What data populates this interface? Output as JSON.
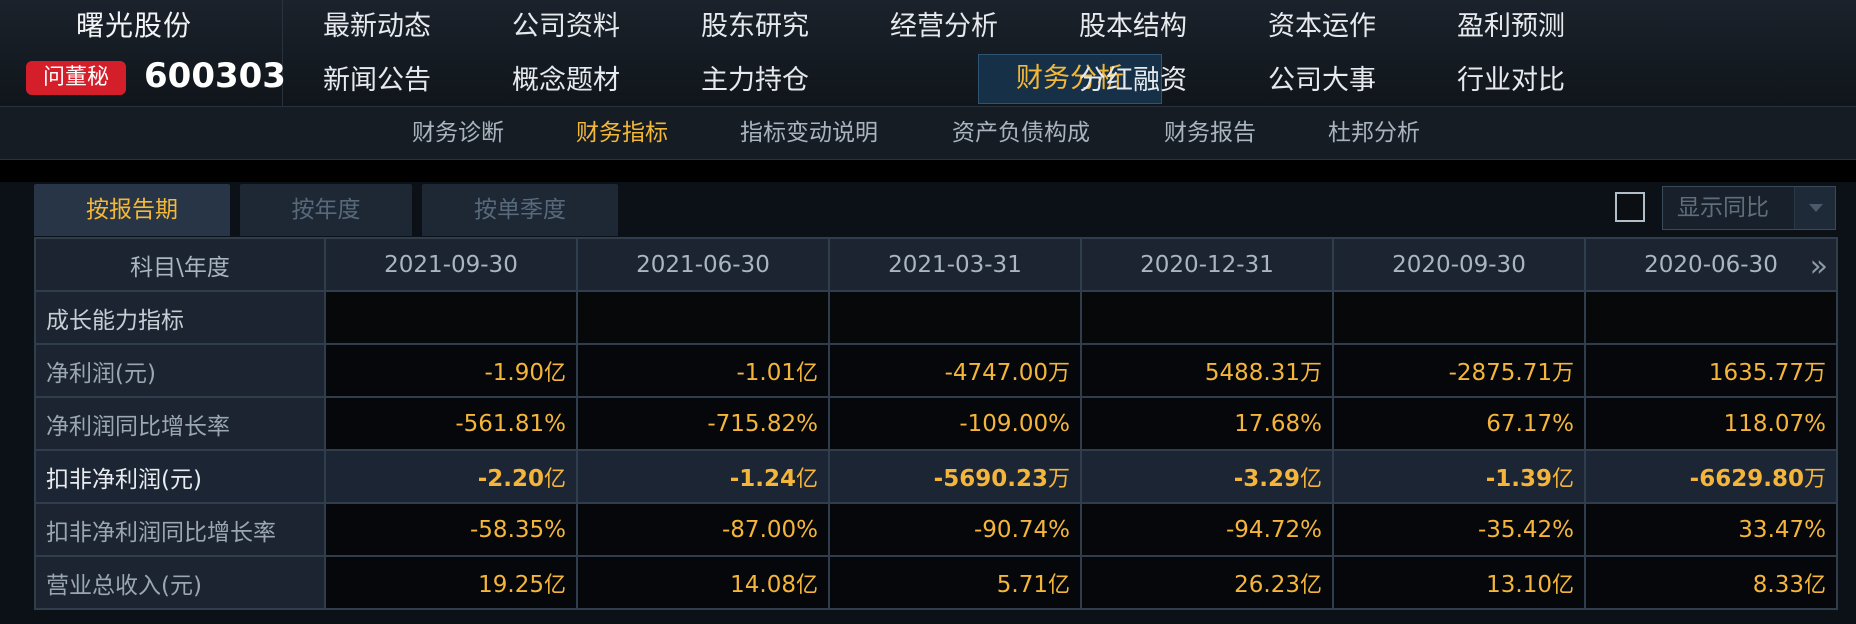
{
  "header": {
    "company_name": "曙光股份",
    "badge_label": "问董秘",
    "stock_code": "600303"
  },
  "nav": {
    "row1": [
      "最新动态",
      "公司资料",
      "股东研究",
      "经营分析",
      "股本结构",
      "资本运作",
      "盈利预测"
    ],
    "row2": [
      "新闻公告",
      "概念题材",
      "主力持仓",
      "财务分析",
      "分红融资",
      "公司大事",
      "行业对比"
    ],
    "active": "财务分析"
  },
  "subnav": {
    "items": [
      "财务诊断",
      "财务指标",
      "指标变动说明",
      "资产负债构成",
      "财务报告",
      "杜邦分析"
    ],
    "active": "财务指标"
  },
  "tabs": {
    "items": [
      "按报告期",
      "按年度",
      "按单季度"
    ],
    "active": "按报告期"
  },
  "options": {
    "compare_label": "显示同比",
    "compare_checked": false
  },
  "table": {
    "header_label": "科目\\年度",
    "columns": [
      "2021-09-30",
      "2021-06-30",
      "2021-03-31",
      "2020-12-31",
      "2020-09-30",
      "2020-06-30"
    ],
    "rows": [
      {
        "label": "成长能力指标",
        "type": "section",
        "cells": []
      },
      {
        "label": "净利润(元)",
        "type": "normal",
        "cells": [
          {
            "num": "-1.90",
            "unit": "亿"
          },
          {
            "num": "-1.01",
            "unit": "亿"
          },
          {
            "num": "-4747.00",
            "unit": "万"
          },
          {
            "num": "5488.31",
            "unit": "万"
          },
          {
            "num": "-2875.71",
            "unit": "万"
          },
          {
            "num": "1635.77",
            "unit": "万"
          }
        ]
      },
      {
        "label": "净利润同比增长率",
        "type": "normal",
        "cells": [
          {
            "num": "-561.81%",
            "unit": ""
          },
          {
            "num": "-715.82%",
            "unit": ""
          },
          {
            "num": "-109.00%",
            "unit": ""
          },
          {
            "num": "17.68%",
            "unit": ""
          },
          {
            "num": "67.17%",
            "unit": ""
          },
          {
            "num": "118.07%",
            "unit": ""
          }
        ]
      },
      {
        "label": "扣非净利润(元)",
        "type": "bold",
        "cells": [
          {
            "num": "-2.20",
            "unit": "亿"
          },
          {
            "num": "-1.24",
            "unit": "亿"
          },
          {
            "num": "-5690.23",
            "unit": "万"
          },
          {
            "num": "-3.29",
            "unit": "亿"
          },
          {
            "num": "-1.39",
            "unit": "亿"
          },
          {
            "num": "-6629.80",
            "unit": "万"
          }
        ]
      },
      {
        "label": "扣非净利润同比增长率",
        "type": "normal",
        "cells": [
          {
            "num": "-58.35%",
            "unit": ""
          },
          {
            "num": "-87.00%",
            "unit": ""
          },
          {
            "num": "-90.74%",
            "unit": ""
          },
          {
            "num": "-94.72%",
            "unit": ""
          },
          {
            "num": "-35.42%",
            "unit": ""
          },
          {
            "num": "33.47%",
            "unit": ""
          }
        ]
      },
      {
        "label": "营业总收入(元)",
        "type": "normal",
        "cells": [
          {
            "num": "19.25",
            "unit": "亿"
          },
          {
            "num": "14.08",
            "unit": "亿"
          },
          {
            "num": "5.71",
            "unit": "亿"
          },
          {
            "num": "26.23",
            "unit": "亿"
          },
          {
            "num": "13.10",
            "unit": "亿"
          },
          {
            "num": "8.33",
            "unit": "亿"
          }
        ]
      }
    ]
  },
  "icons": {
    "next_columns": "double-chevron-right-icon",
    "compare_dropdown": "caret-down-icon"
  },
  "colors": {
    "accent": "#f4b838",
    "badge": "#d41f2a",
    "value": "#f4b53a"
  }
}
